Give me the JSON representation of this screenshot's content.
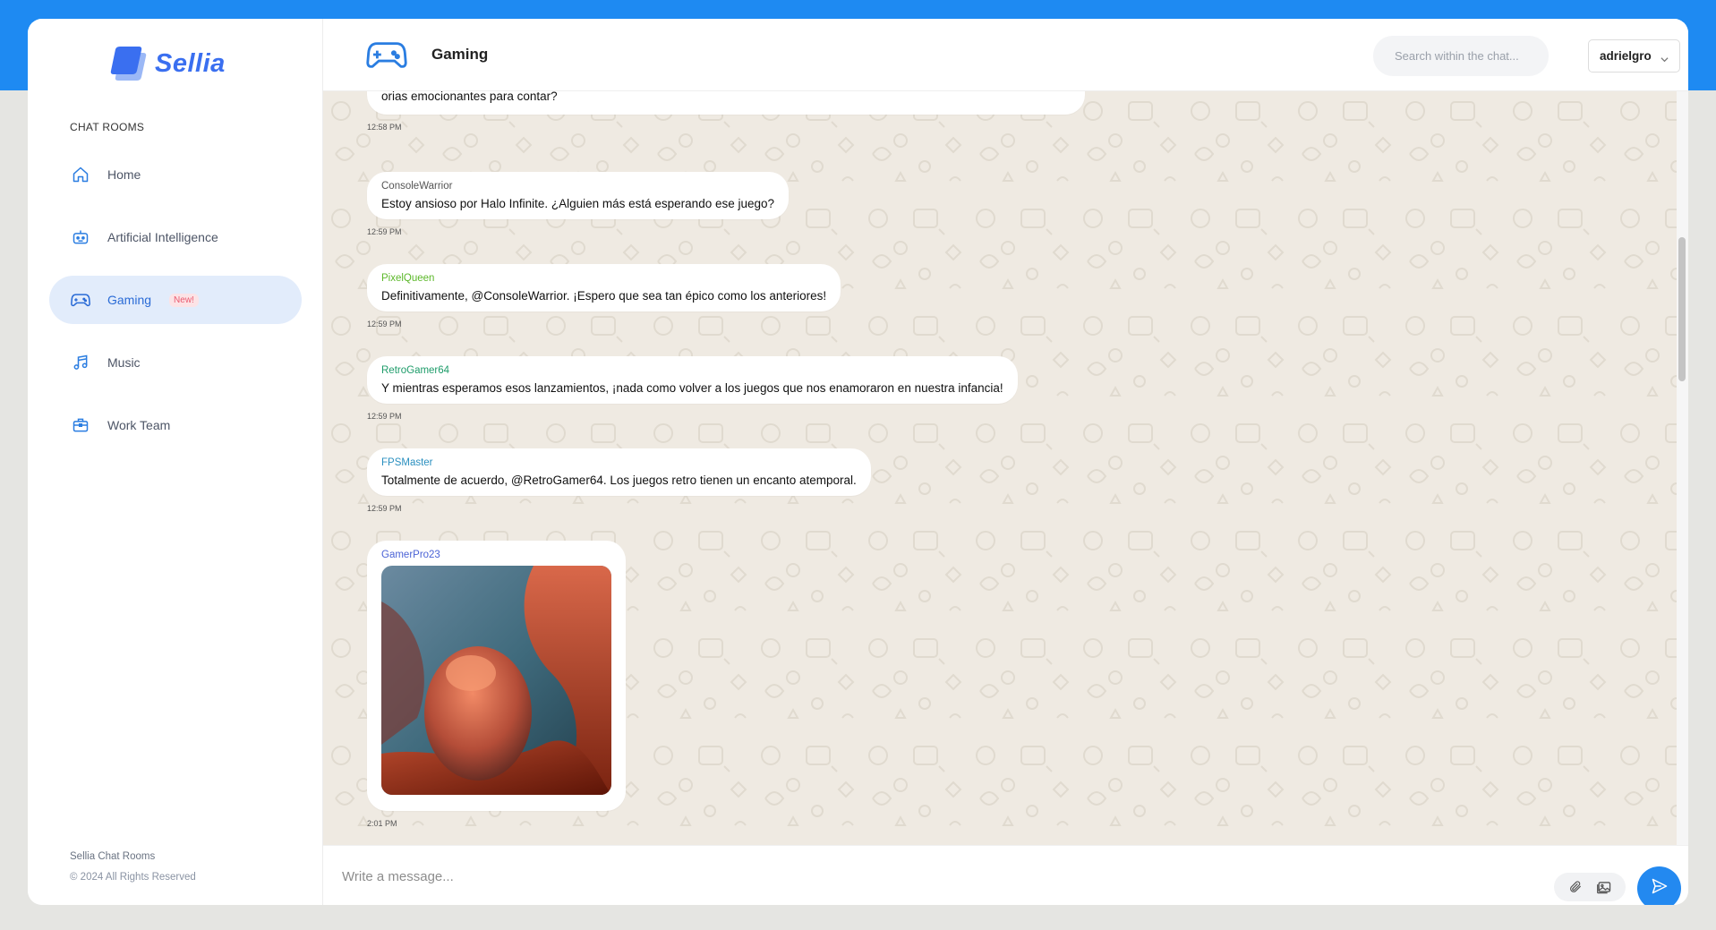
{
  "brand": {
    "name": "Sellia",
    "accent": "#3a6ff0"
  },
  "sidebar": {
    "section_label": "CHAT ROOMS",
    "items": [
      {
        "label": "Home",
        "icon": "home-icon",
        "badge": ""
      },
      {
        "label": "Artificial Intelligence",
        "icon": "robot-icon",
        "badge": ""
      },
      {
        "label": "Gaming",
        "icon": "gamepad-icon",
        "badge": "New!",
        "active": true
      },
      {
        "label": "Music",
        "icon": "music-note-icon",
        "badge": ""
      },
      {
        "label": "Work Team",
        "icon": "briefcase-icon",
        "badge": ""
      }
    ],
    "footer_title": "Sellia Chat Rooms",
    "footer_copyright": "© 2024 All Rights Reserved"
  },
  "header": {
    "room_title": "Gaming",
    "room_icon": "gamepad-icon",
    "search_placeholder": "Search within the chat...",
    "user": "adrielgro"
  },
  "messages": [
    {
      "sender": "",
      "text": "orias emocionantes para contar?",
      "time": "12:58 PM",
      "sender_color": "#666666"
    },
    {
      "sender": "ConsoleWarrior",
      "text": "Estoy ansioso por Halo Infinite. ¿Alguien más está esperando ese juego?",
      "time": "12:59 PM",
      "sender_color": "#555555"
    },
    {
      "sender": "PixelQueen",
      "text": "Definitivamente, @ConsoleWarrior. ¡Espero que sea tan épico como los anteriores!",
      "time": "12:59 PM",
      "sender_color": "#5cb82a"
    },
    {
      "sender": "RetroGamer64",
      "text": "Y mientras esperamos esos lanzamientos, ¡nada como volver a los juegos que nos enamoraron en nuestra infancia!",
      "time": "12:59 PM",
      "sender_color": "#1e9c6a"
    },
    {
      "sender": "FPSMaster",
      "text": "Totalmente de acuerdo, @RetroGamer64. Los juegos retro tienen un encanto atemporal.",
      "time": "12:59 PM",
      "sender_color": "#2a8fbf"
    },
    {
      "sender": "GamerPro23",
      "text": "",
      "time": "2:01 PM",
      "sender_color": "#4b63d6",
      "image": "abstract-3d-shapes-image"
    }
  ],
  "composer": {
    "placeholder": "Write a message...",
    "attach_icon": "paperclip-icon",
    "image_icon": "image-icon",
    "send_icon": "send-icon",
    "send_color": "#2389f0"
  }
}
